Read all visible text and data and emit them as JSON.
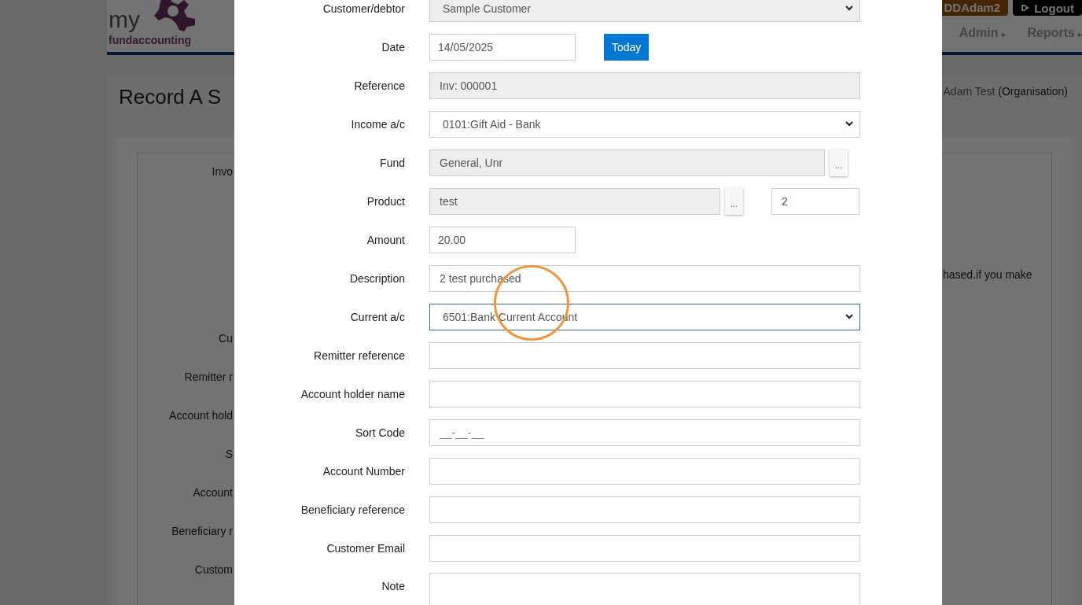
{
  "header": {
    "logo_top": "my",
    "logo_bottom": "fundaccounting",
    "user_badge": "DDAdam2",
    "logout": "Logout",
    "nav": [
      {
        "label": "Admin",
        "arrow": "▸"
      },
      {
        "label": "Reports",
        "arrow": "▸"
      }
    ]
  },
  "page": {
    "title": "Record A S",
    "organisation_name": "Adam Test",
    "organisation_kind": "(Organisation)",
    "invoice_label": "Invo",
    "labels": [
      "Cu",
      "Remitter r",
      "Account hold",
      "S",
      "Account",
      "Beneficiary r",
      "Custom"
    ],
    "note": "hased.if you make"
  },
  "modal": {
    "fields": [
      {
        "label": "Customer/debtor",
        "kind": "select",
        "value": "Sample Customer",
        "disabled": true,
        "focused": false
      },
      {
        "label": "Date",
        "kind": "date",
        "value": "14/05/2025",
        "button": "Today",
        "disabled": false,
        "focused": false
      },
      {
        "label": "Reference",
        "kind": "text",
        "value": "Inv: 000001",
        "disabled": true,
        "focused": false
      },
      {
        "label": "Income a/c",
        "kind": "select",
        "value": "0101:Gift Aid - Bank",
        "disabled": false,
        "focused": false
      },
      {
        "label": "Fund",
        "kind": "picker",
        "value": "General, Unr",
        "button": "...",
        "disabled": true,
        "focused": false
      },
      {
        "label": "Product",
        "kind": "product",
        "value": "test",
        "button": "...",
        "quantity": "2",
        "disabled": true,
        "focused": false
      },
      {
        "label": "Amount",
        "kind": "short",
        "value": "20.00",
        "disabled": false,
        "focused": false
      },
      {
        "label": "Description",
        "kind": "text",
        "value": "2 test purchased",
        "disabled": false,
        "focused": false
      },
      {
        "label": "Current a/c",
        "kind": "select",
        "value": "6501:Bank Current Account",
        "disabled": false,
        "focused": true
      },
      {
        "label": "Remitter reference",
        "kind": "text",
        "disabled": false,
        "focused": false
      },
      {
        "label": "Account holder name",
        "kind": "text",
        "disabled": false,
        "focused": false
      },
      {
        "label": "Sort Code",
        "kind": "text",
        "placeholder": "__-__-__",
        "disabled": false,
        "focused": false
      },
      {
        "label": "Account Number",
        "kind": "text",
        "disabled": false,
        "focused": false
      },
      {
        "label": "Beneficiary reference",
        "kind": "text",
        "disabled": false,
        "focused": false
      },
      {
        "label": "Customer Email",
        "kind": "text",
        "disabled": false,
        "focused": false
      },
      {
        "label": "Note",
        "kind": "textarea",
        "disabled": false,
        "focused": false
      }
    ]
  }
}
